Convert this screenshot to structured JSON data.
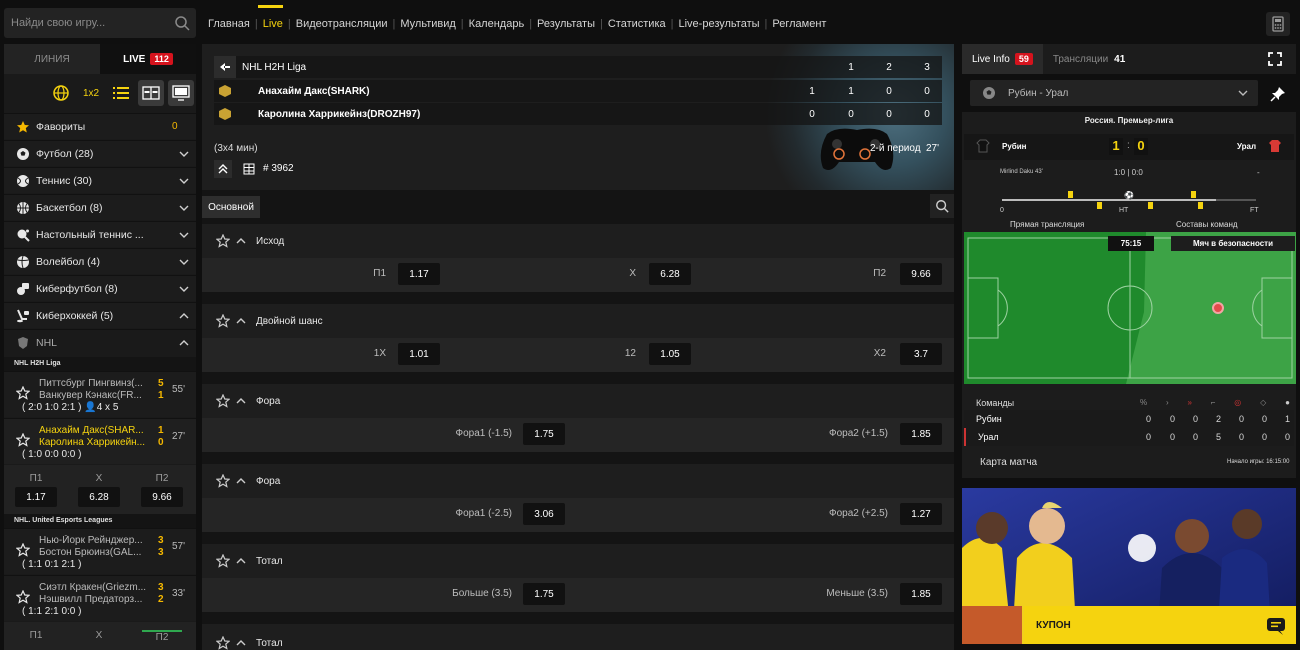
{
  "search": {
    "placeholder": "Найди свою игру..."
  },
  "nav": [
    "Главная",
    "Live",
    "Видеотрансляции",
    "Мультивид",
    "Календарь",
    "Результаты",
    "Статистика",
    "Live-результаты",
    "Регламент"
  ],
  "left": {
    "tab_line": "ЛИНИЯ",
    "tab_live": "LIVE",
    "live_count": "112",
    "tool_1x2": "1x2",
    "sports": [
      {
        "label": "Фавориты",
        "count": "0"
      },
      {
        "label": "Футбол (28)"
      },
      {
        "label": "Теннис (30)"
      },
      {
        "label": "Баскетбол (8)"
      },
      {
        "label": "Настольный теннис ..."
      },
      {
        "label": "Волейбол (4)"
      },
      {
        "label": "Киберфутбол (8)"
      },
      {
        "label": "Киберхоккей (5)"
      }
    ],
    "nhl": "NHL",
    "league1": "NHL H2H Liga",
    "m1": {
      "t1": "Питтсбург Пингвинз(...",
      "t2": "Ванкувер Кэнакс(FR...",
      "s1": "5",
      "s2": "1",
      "min": "55'",
      "score": "( 2:0  1:0  2:1 )",
      "people": "4 x 5"
    },
    "m2": {
      "t1": "Анахайм Дакс(SHAR...",
      "t2": "Каролина Харрикейн...",
      "s1": "1",
      "s2": "0",
      "min": "27'",
      "score": "( 1:0  0:0  0:0 )"
    },
    "odds": {
      "h1": "П1",
      "h2": "X",
      "h3": "П2",
      "v1": "1.17",
      "v2": "6.28",
      "v3": "9.66"
    },
    "league2": "NHL. United Esports Leagues",
    "m3": {
      "t1": "Нью-Йорк Рейнджер...",
      "t2": "Бостон Брюинз(GAL...",
      "s1": "3",
      "s2": "3",
      "min": "57'",
      "score": "( 1:1  0:1  2:1 )"
    },
    "m4": {
      "t1": "Сиэтл Кракен(Griezm...",
      "t2": "Нэшвилл Предаторз...",
      "s1": "3",
      "s2": "2",
      "min": "33'",
      "score": "( 1:1  2:1  0:0 )"
    },
    "odds2": {
      "h1": "П1",
      "h2": "X",
      "h3": "П2"
    }
  },
  "match": {
    "league": "NHL H2H Liga",
    "periods": [
      "1",
      "2",
      "3"
    ],
    "team1": "Анахайм Дакс(SHARK)",
    "team2": "Каролина Харрикейнз(DROZH97)",
    "t1_scores": [
      "1",
      "1",
      "0",
      "0"
    ],
    "t2_scores": [
      "0",
      "0",
      "0",
      "0"
    ],
    "format": "(3x4 мин)",
    "id": "# 3962",
    "period": "2-й период",
    "minute": "27'"
  },
  "main_tab": "Основной",
  "markets": [
    {
      "title": "Исход",
      "o": [
        [
          "П1",
          "1.17"
        ],
        [
          "X",
          "6.28"
        ],
        [
          "П2",
          "9.66"
        ]
      ]
    },
    {
      "title": "Двойной шанс",
      "o": [
        [
          "1X",
          "1.01"
        ],
        [
          "12",
          "1.05"
        ],
        [
          "X2",
          "3.7"
        ]
      ]
    },
    {
      "title": "Фора",
      "o": [
        [
          "Фора1 (-1.5)",
          "1.75"
        ],
        [
          "Фора2 (+1.5)",
          "1.85"
        ]
      ]
    },
    {
      "title": "Фора",
      "o": [
        [
          "Фора1 (-2.5)",
          "3.06"
        ],
        [
          "Фора2 (+2.5)",
          "1.27"
        ]
      ]
    },
    {
      "title": "Тотал",
      "o": [
        [
          "Больше (3.5)",
          "1.75"
        ],
        [
          "Меньше (3.5)",
          "1.85"
        ]
      ]
    },
    {
      "title": "Тотал"
    }
  ],
  "right": {
    "tab_info": "Live Info",
    "info_count": "59",
    "tab_trans": "Трансляции",
    "trans_count": "41",
    "select": "Рубин - Урал",
    "league": "Россия. Премьер-лига",
    "home": "Рубин",
    "away": "Урал",
    "hs": "1",
    "as": "0",
    "scorer": "Mirlind Daku 43'",
    "ht": "1:0 | 0:0",
    "dash": "-",
    "tl0": "0",
    "tlht": "HT",
    "tlft": "FT",
    "live_link": "Прямая трансляция",
    "lineup_link": "Составы команд",
    "clock": "75:15",
    "status": "Мяч в безопасности",
    "teams_hdr": "Команды",
    "stats_home": [
      "0",
      "0",
      "0",
      "2",
      "0",
      "0",
      "1"
    ],
    "stats_away": [
      "0",
      "0",
      "0",
      "5",
      "0",
      "0",
      "0"
    ],
    "map": "Карта матча",
    "start": "Начало игры: 16:15:00"
  },
  "coupon": "КУПОН",
  "colors": {
    "accent": "#f5d30f",
    "live_badge": "#d5131d",
    "field": "#1f8a2c"
  }
}
